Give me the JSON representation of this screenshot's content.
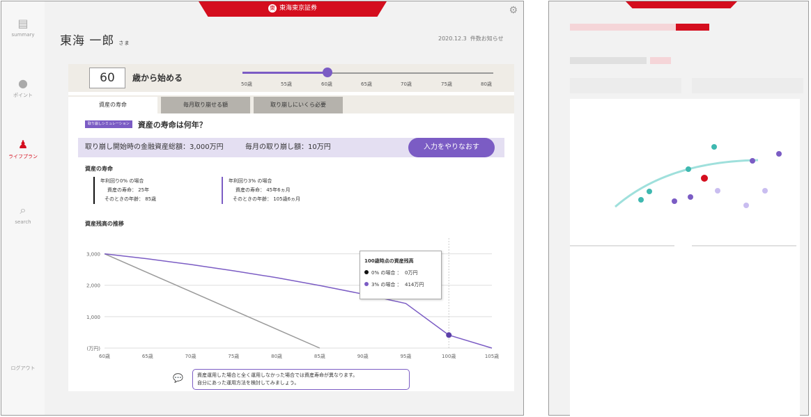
{
  "header": {
    "brand": "東海東京証券"
  },
  "sidebar": {
    "items": [
      {
        "label": "summary",
        "icon": "briefcase-icon",
        "active": false
      },
      {
        "label": "ポイント",
        "icon": "coin-icon",
        "active": false
      },
      {
        "label": "ライフプラン",
        "icon": "person-icon",
        "active": true
      },
      {
        "label": "search",
        "icon": "search-icon",
        "active": false
      },
      {
        "label": "ログアウト",
        "icon": "logout-icon",
        "active": false
      }
    ]
  },
  "user": {
    "name": "東海 一郎",
    "suffix": "さま",
    "date": "2020.12.3",
    "updated": "件数お知らせ"
  },
  "slider": {
    "value": "60",
    "label": "歳から始める",
    "ticks": [
      "50歳",
      "55歳",
      "60歳",
      "65歳",
      "70歳",
      "75歳",
      "80歳"
    ],
    "selected_index": 2,
    "accent": "#7b5cc4"
  },
  "tabs": [
    {
      "label": "資産の寿命",
      "active": true
    },
    {
      "label": "毎月取り崩せる額",
      "active": false
    },
    {
      "label": "取り崩しにいくら必要",
      "active": false
    }
  ],
  "question": {
    "badge": "取り崩しシミュレーション",
    "title": "資産の寿命は何年？"
  },
  "infobar": {
    "start_assets": "取り崩し開始時の金融資産総額：3,000万円",
    "monthly": "毎月の取り崩し額：10万円",
    "redo_label": "入力をやりなおす"
  },
  "lifespan": {
    "title": "資産の寿命",
    "case0": {
      "head": "年利回り0% の場合",
      "life": "資産の寿命： 25年",
      "age": "そのときの年齢： 85歳"
    },
    "case3": {
      "head": "年利回り3% の場合",
      "life": "資産の寿命： 45年6ヵ月",
      "age": "そのときの年齢： 105歳6ヵ月"
    }
  },
  "chart_title": "資産残高の推移",
  "tooltip": {
    "title": "100歳時点の資産残高",
    "row0": "0% の場合 ：",
    "row0v": "0万円",
    "row3": "3% の場合 ：",
    "row3v": "414万円"
  },
  "advice": {
    "line1": "資産運用した場合と全く運用しなかった場合では資産寿命が異なります。",
    "line2": "自分にあった運用方法を検討してみましょう。"
  },
  "chart_data": {
    "type": "line",
    "x": [
      60,
      65,
      70,
      75,
      80,
      85,
      90,
      95,
      100,
      105
    ],
    "x_tick_labels": [
      "60歳",
      "65歳",
      "70歳",
      "75歳",
      "80歳",
      "85歳",
      "90歳",
      "95歳",
      "100歳",
      "105歳"
    ],
    "y_tick_labels": [
      "(万円)",
      "1,000",
      "2,000",
      "3,000"
    ],
    "ylim": [
      0,
      3500
    ],
    "series": [
      {
        "name": "0% の場合",
        "color": "#999999",
        "values": [
          3000,
          2400,
          1800,
          1200,
          600,
          0,
          null,
          null,
          null,
          null
        ]
      },
      {
        "name": "3% の場合",
        "color": "#7b5cc4",
        "values": [
          3000,
          2840,
          2660,
          2460,
          2240,
          1990,
          1720,
          1420,
          414,
          0
        ]
      }
    ],
    "highlight": {
      "x": 100,
      "y": 414
    }
  },
  "colors": {
    "brand_red": "#d40e1e",
    "accent_purple": "#7b5cc4"
  }
}
